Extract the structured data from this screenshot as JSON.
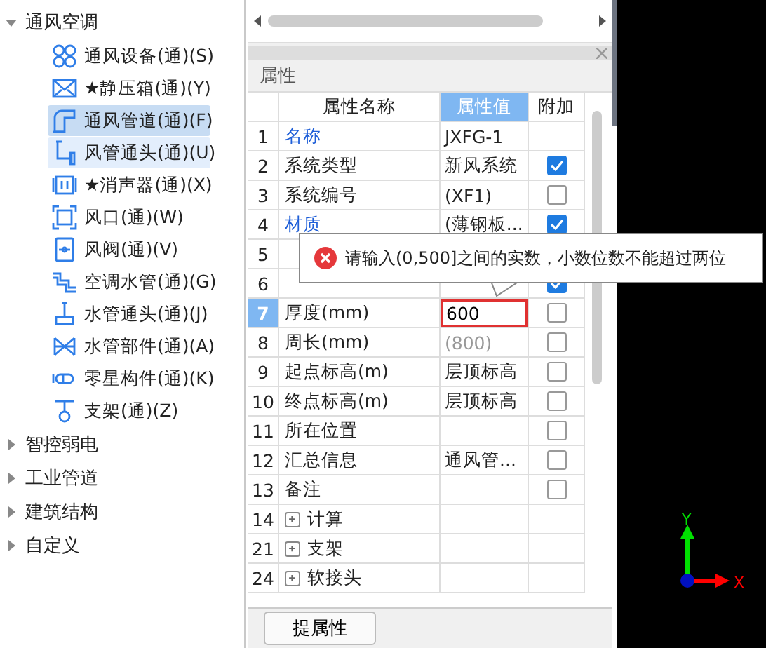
{
  "tree": [
    {
      "label": "通风空调",
      "expanded": true,
      "children": [
        {
          "label": "通风设备(通)(S)",
          "selected": false,
          "hovered": false
        },
        {
          "label": "★静压箱(通)(Y)",
          "selected": false,
          "hovered": false
        },
        {
          "label": "通风管道(通)(F)",
          "selected": true,
          "hovered": false
        },
        {
          "label": "风管通头(通)(U)",
          "selected": false,
          "hovered": true
        },
        {
          "label": "★消声器(通)(X)",
          "selected": false,
          "hovered": false
        },
        {
          "label": "风口(通)(W)",
          "selected": false,
          "hovered": false
        },
        {
          "label": "风阀(通)(V)",
          "selected": false,
          "hovered": false
        },
        {
          "label": "空调水管(通)(G)",
          "selected": false,
          "hovered": false
        },
        {
          "label": "水管通头(通)(J)",
          "selected": false,
          "hovered": false
        },
        {
          "label": "水管部件(通)(A)",
          "selected": false,
          "hovered": false
        },
        {
          "label": "零星构件(通)(K)",
          "selected": false,
          "hovered": false
        },
        {
          "label": "支架(通)(Z)",
          "selected": false,
          "hovered": false
        }
      ]
    },
    {
      "label": "智控弱电",
      "expanded": false
    },
    {
      "label": "工业管道",
      "expanded": false
    },
    {
      "label": "建筑结构",
      "expanded": false
    },
    {
      "label": "自定义",
      "expanded": false
    }
  ],
  "properties": {
    "title": "属性",
    "columns": [
      {
        "label": "属性名称",
        "selected": false
      },
      {
        "label": "属性值",
        "selected": true
      },
      {
        "label": "附加",
        "selected": false
      }
    ],
    "rows": [
      {
        "kind": "field",
        "index": "1",
        "name": "名称",
        "linked": true,
        "value": "JXFG-1",
        "selected": false
      },
      {
        "kind": "field",
        "index": "2",
        "name": "系统类型",
        "linked": false,
        "value": "新风系统",
        "checked": true,
        "selected": false
      },
      {
        "kind": "field",
        "index": "3",
        "name": "系统编号",
        "linked": false,
        "value": "(XF1)",
        "checked": false,
        "selected": false
      },
      {
        "kind": "field",
        "index": "4",
        "name": "材质",
        "linked": true,
        "value": "(薄钢板...",
        "checked": true,
        "selected": false
      },
      {
        "kind": "field",
        "index": "5",
        "selected": false
      },
      {
        "kind": "field",
        "index": "6",
        "checked": true,
        "selected": false
      },
      {
        "kind": "field",
        "index": "7",
        "name": "厚度(mm)",
        "linked": false,
        "value": "600",
        "editing": true,
        "checked": false,
        "selected": true
      },
      {
        "kind": "field",
        "index": "8",
        "name": "周长(mm)",
        "linked": false,
        "value": "(800)",
        "dimmed": true,
        "checked": false,
        "selected": false
      },
      {
        "kind": "field",
        "index": "9",
        "name": "起点标高(m)",
        "linked": false,
        "value": "层顶标高",
        "checked": false,
        "selected": false
      },
      {
        "kind": "field",
        "index": "10",
        "name": "终点标高(m)",
        "linked": false,
        "value": "层顶标高",
        "checked": false,
        "selected": false
      },
      {
        "kind": "field",
        "index": "11",
        "name": "所在位置",
        "linked": false,
        "checked": false,
        "selected": false
      },
      {
        "kind": "field",
        "index": "12",
        "name": "汇总信息",
        "linked": false,
        "value": "通风管...",
        "checked": false,
        "selected": false
      },
      {
        "kind": "field",
        "index": "13",
        "name": "备注",
        "linked": false,
        "checked": false,
        "selected": false
      },
      {
        "kind": "group",
        "index": "14",
        "name": "计算",
        "selected": false
      },
      {
        "kind": "group",
        "index": "21",
        "name": "支架",
        "selected": false
      },
      {
        "kind": "group",
        "index": "24",
        "name": "软接头",
        "selected": false
      }
    ],
    "tooltip": "请输入(0,500]之间的实数，小数位数不能超过两位",
    "button": "提属性"
  },
  "viewport": {
    "axes": {
      "x": "X",
      "y": "Y"
    }
  }
}
